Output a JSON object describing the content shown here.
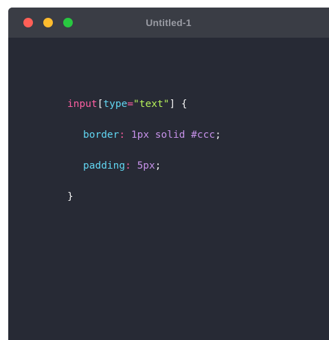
{
  "window": {
    "title": "Untitled-1",
    "buttons": {
      "close_color": "#ff5f57",
      "minimize_color": "#febc2e",
      "maximize_color": "#28c840"
    }
  },
  "code": {
    "selector_tag": "input",
    "bracket_open": "[",
    "attr_name": "type",
    "equals": "=",
    "attr_value": "\"text\"",
    "bracket_close": "]",
    "brace_open": " {",
    "decl1_prop": "border",
    "decl1_colon": ": ",
    "decl1_value": "1px solid #ccc",
    "decl1_semicolon": ";",
    "decl2_prop": "padding",
    "decl2_colon": ": ",
    "decl2_value": "5px",
    "decl2_semicolon": ";",
    "brace_close": "}"
  },
  "colors": {
    "tag": "#ff5fa2",
    "attr": "#61d6f2",
    "value_string": "#b6f25a",
    "property": "#61d6f2",
    "number": "#c792ea",
    "punct": "#f5f5f5"
  }
}
